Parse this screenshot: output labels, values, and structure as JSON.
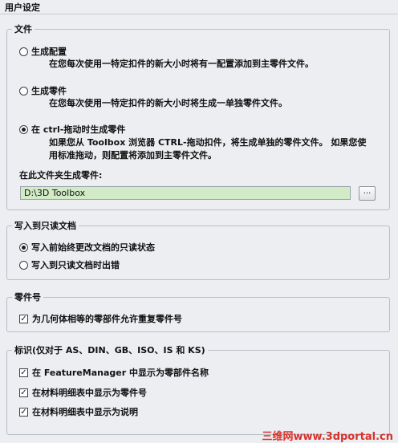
{
  "header": {
    "title": "用户设定"
  },
  "file_group": {
    "title": "文件",
    "options": [
      {
        "label": "生成配置",
        "desc_line1": "在您每次使用一特定扣件的新大小时将有一配置添加到主零件文件。",
        "desc_line2": "",
        "selected": false
      },
      {
        "label": "生成零件",
        "desc_line1": "在您每次使用一特定扣件的新大小时将生成一单独零件文件。",
        "desc_line2": "",
        "selected": false
      },
      {
        "label": "在 ctrl-拖动时生成零件",
        "desc_line1": "如果您从 Toolbox 浏览器 CTRL-拖动扣件，将生成单独的零件文件。 如果您使",
        "desc_line2": "用标准拖动，则配置将添加到主零件文件。",
        "selected": true
      }
    ],
    "folder_label": "在此文件夹生成零件:",
    "folder_value": "D:\\3D Toolbox",
    "browse_label": "..."
  },
  "readonly_group": {
    "title": "写入到只读文档",
    "options": [
      {
        "label": "写入前始终更改文档的只读状态",
        "selected": true
      },
      {
        "label": "写入到只读文档时出错",
        "selected": false
      }
    ]
  },
  "part_number_group": {
    "title": "零件号",
    "check_label": "为几何体相等的零部件允许重复零件号",
    "checked": true
  },
  "mark_group": {
    "title": "标识(仅对于 AS、DIN、GB、ISO、IS 和 KS)",
    "checks": [
      {
        "label": "在 FeatureManager 中显示为零部件名称",
        "checked": true
      },
      {
        "label": "在材料明细表中显示为零件号",
        "checked": true
      },
      {
        "label": "在材料明细表中显示为说明",
        "checked": true
      }
    ]
  },
  "watermark": "三维网www.3dportal.cn",
  "icons": {
    "check": "✓",
    "radio_on": "radio-filled"
  }
}
